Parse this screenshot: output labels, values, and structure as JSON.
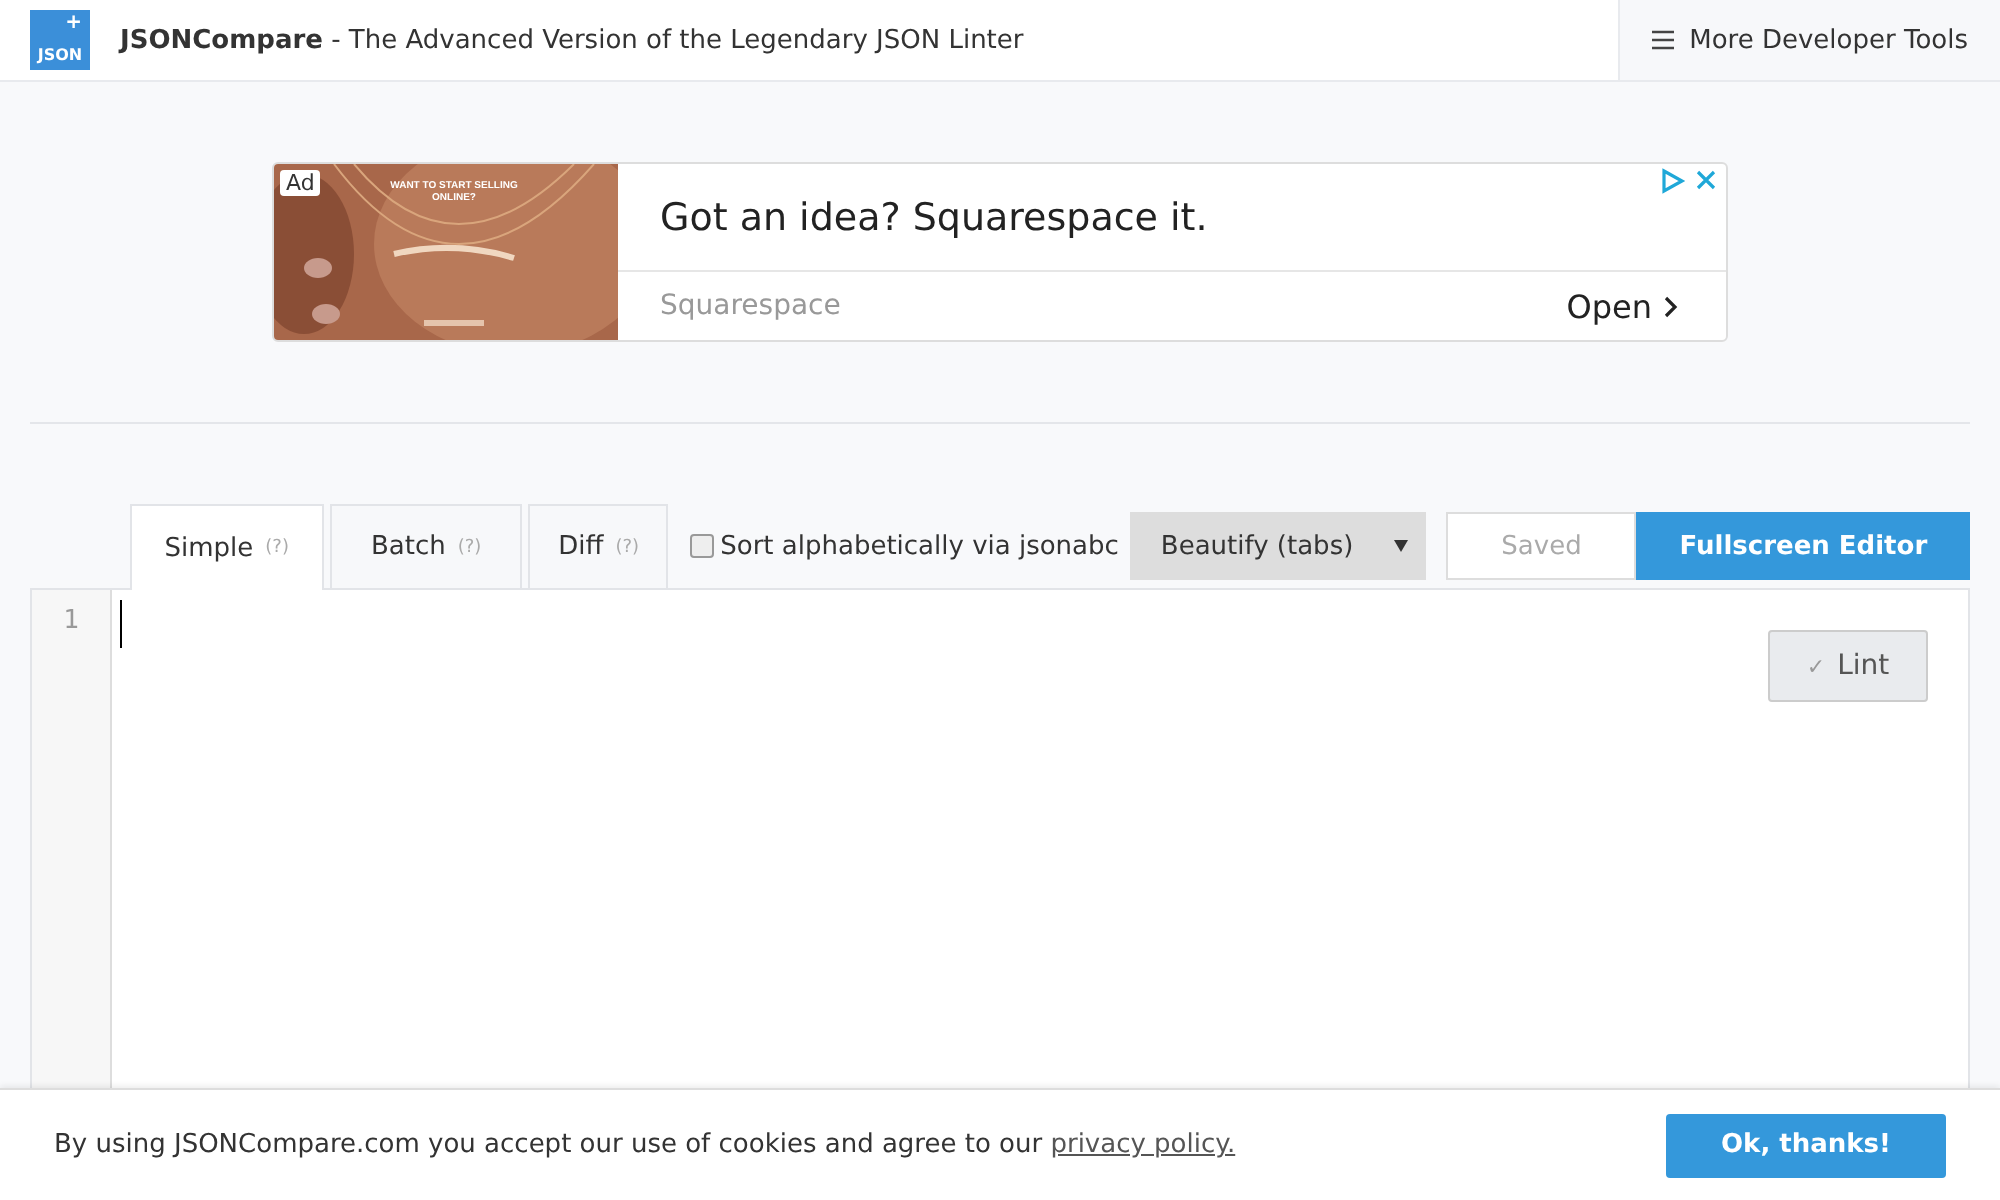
{
  "header": {
    "logo": {
      "plus": "+",
      "text": "JSON"
    },
    "brand": "JSONCompare",
    "tagline": " - The Advanced Version of the Legendary JSON Linter",
    "menu_button": "More Developer Tools"
  },
  "ad": {
    "badge": "Ad",
    "picture_caption_top": "WANT TO START SELLING ONLINE?",
    "headline": "Got an idea? Squarespace it.",
    "advertiser": "Squarespace",
    "action": "Open"
  },
  "tabs": [
    {
      "label": "Simple",
      "hint": "(?)",
      "selected": true
    },
    {
      "label": "Batch",
      "hint": "(?)",
      "selected": false
    },
    {
      "label": "Diff",
      "hint": "(?)",
      "selected": false
    }
  ],
  "sort_option": {
    "label": "Sort alphabetically via jsonabc",
    "checked": false
  },
  "format_select": {
    "value": "Beautify (tabs)"
  },
  "saved_button": "Saved",
  "fullscreen_button": "Fullscreen Editor",
  "editor": {
    "line_numbers": [
      "1"
    ],
    "lint_button": {
      "check": "✓",
      "label": "Lint"
    }
  },
  "cookie_bar": {
    "text": "By using JSONCompare.com you accept our use of cookies and agree to our ",
    "link": "privacy policy.",
    "button": "Ok, thanks!"
  }
}
